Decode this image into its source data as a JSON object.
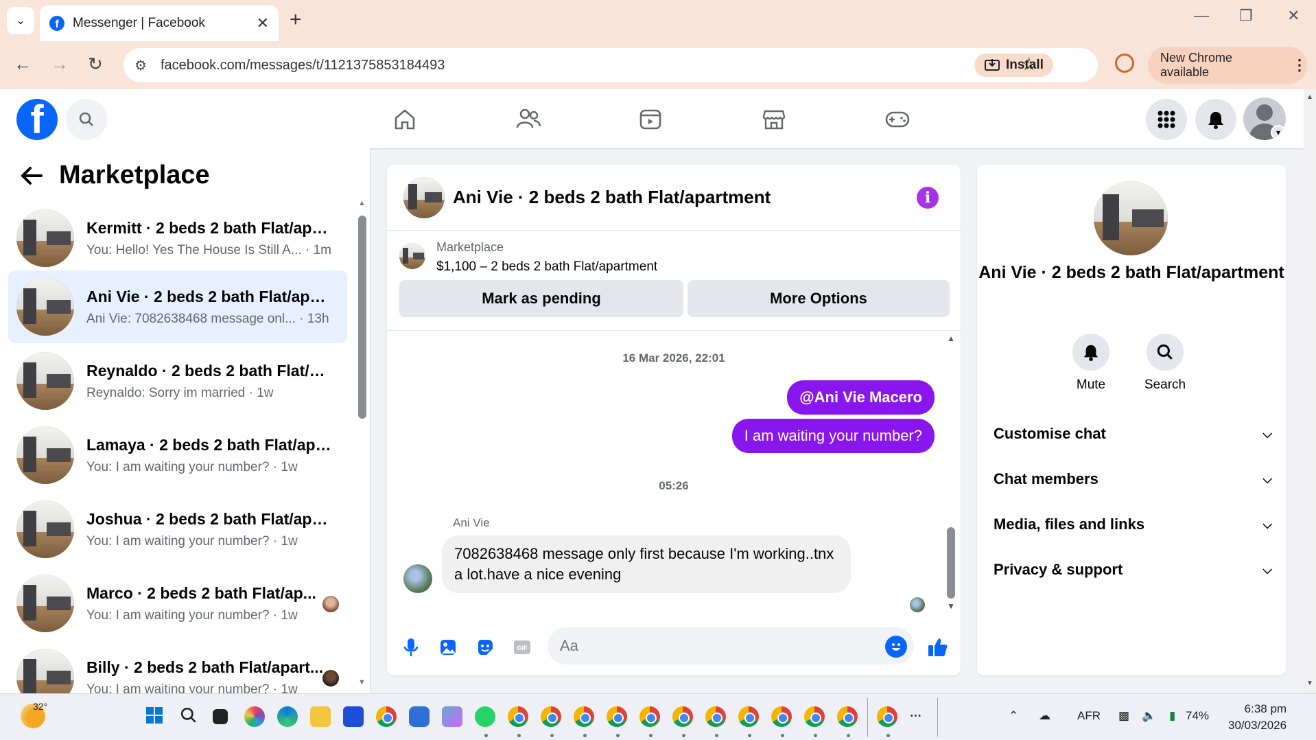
{
  "browser": {
    "tab_title": "Messenger | Facebook",
    "url": "facebook.com/messages/t/1121375853184493",
    "install_label": "Install",
    "new_chrome_label": "New Chrome available"
  },
  "sidebar": {
    "title": "Marketplace",
    "chats": [
      {
        "name": "Kermitt · 2 beds 2 bath Flat/apar...",
        "snippet": "You: Hello! Yes The House Is Still A... · 1m",
        "active": false
      },
      {
        "name": "Ani Vie · 2 beds 2 bath Flat/apar...",
        "snippet": "Ani Vie: 7082638468 message onl... · 13h",
        "active": true
      },
      {
        "name": "Reynaldo · 2 beds 2 bath Flat/ap...",
        "snippet": "Reynaldo: Sorry im married · 1w",
        "active": false
      },
      {
        "name": "Lamaya · 2 beds 2 bath Flat/apa...",
        "snippet": "You: I am waiting your number? · 1w",
        "active": false
      },
      {
        "name": "Joshua · 2 beds 2 bath Flat/apar...",
        "snippet": "You: I am waiting your number? · 1w",
        "active": false
      },
      {
        "name": "Marco · 2 beds 2 bath Flat/ap...",
        "snippet": "You: I am waiting your number? · 1w",
        "active": false
      },
      {
        "name": "Billy · 2 beds 2 bath Flat/apart...",
        "snippet": "You: I am waiting your number? · 1w",
        "active": false
      }
    ]
  },
  "conversation": {
    "title": "Ani Vie · 2 beds 2 bath Flat/apartment",
    "listing_label": "Marketplace",
    "listing_price": "$1,100 – 2 beds 2 bath Flat/apartment",
    "mark_pending_label": "Mark as pending",
    "more_options_label": "More Options",
    "date_1": "16 Mar 2026, 22:01",
    "outgoing_1": "@Ani Vie Macero",
    "outgoing_2": "I am waiting your number?",
    "date_2": "05:26",
    "incoming_sender": "Ani Vie",
    "incoming_message": "7082638468 message only first because I'm working..tnx a lot.have a nice evening",
    "composer_placeholder": "Aa"
  },
  "info_panel": {
    "name": "Ani Vie · 2 beds 2 bath Flat/apartment",
    "mute_label": "Mute",
    "search_label": "Search",
    "sections": [
      "Customise chat",
      "Chat members",
      "Media, files and links",
      "Privacy & support"
    ]
  },
  "taskbar": {
    "temperature": "32°",
    "language": "AFR",
    "battery": "74%",
    "time": "6:38 pm",
    "date": "30/03/2026"
  },
  "colors": {
    "facebook_blue": "#0866ff",
    "messenger_purple": "#8a16ee",
    "active_chat_bg": "#e7f0fe"
  }
}
